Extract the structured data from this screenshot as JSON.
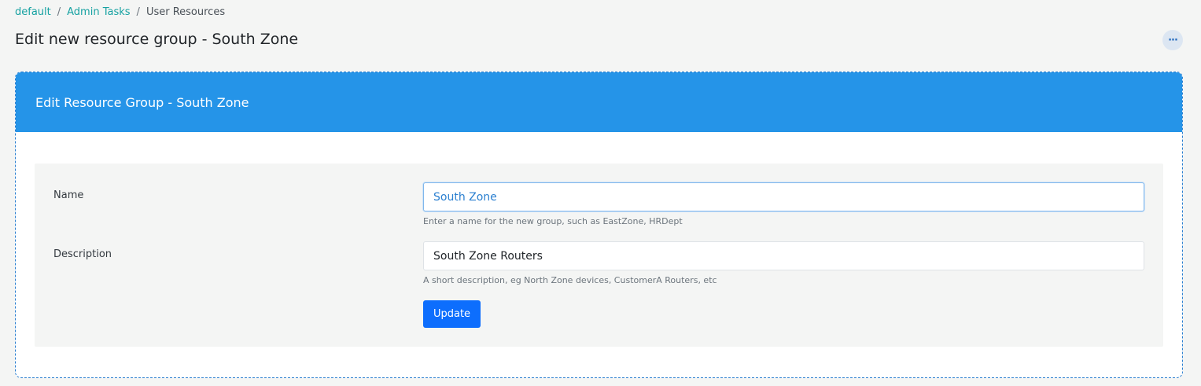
{
  "breadcrumb": {
    "items": [
      "default",
      "Admin Tasks"
    ],
    "current": "User Resources",
    "separator": "/"
  },
  "page": {
    "title": "Edit new resource group - South Zone",
    "more_icon": "more-horizontal-icon",
    "more_glyph": "···"
  },
  "card": {
    "title": "Edit Resource Group - South Zone"
  },
  "form": {
    "name": {
      "label": "Name",
      "value": "South Zone",
      "help": "Enter a name for the new group, such as EastZone, HRDept"
    },
    "description": {
      "label": "Description",
      "value": "South Zone Routers",
      "help": "A short description, eg North Zone devices, CustomerA Routers, etc"
    },
    "submit_label": "Update"
  },
  "colors": {
    "link": "#17a2a2",
    "header_bg": "#2594e8",
    "primary_button": "#0d6efd",
    "page_bg": "#f4f5f4"
  }
}
